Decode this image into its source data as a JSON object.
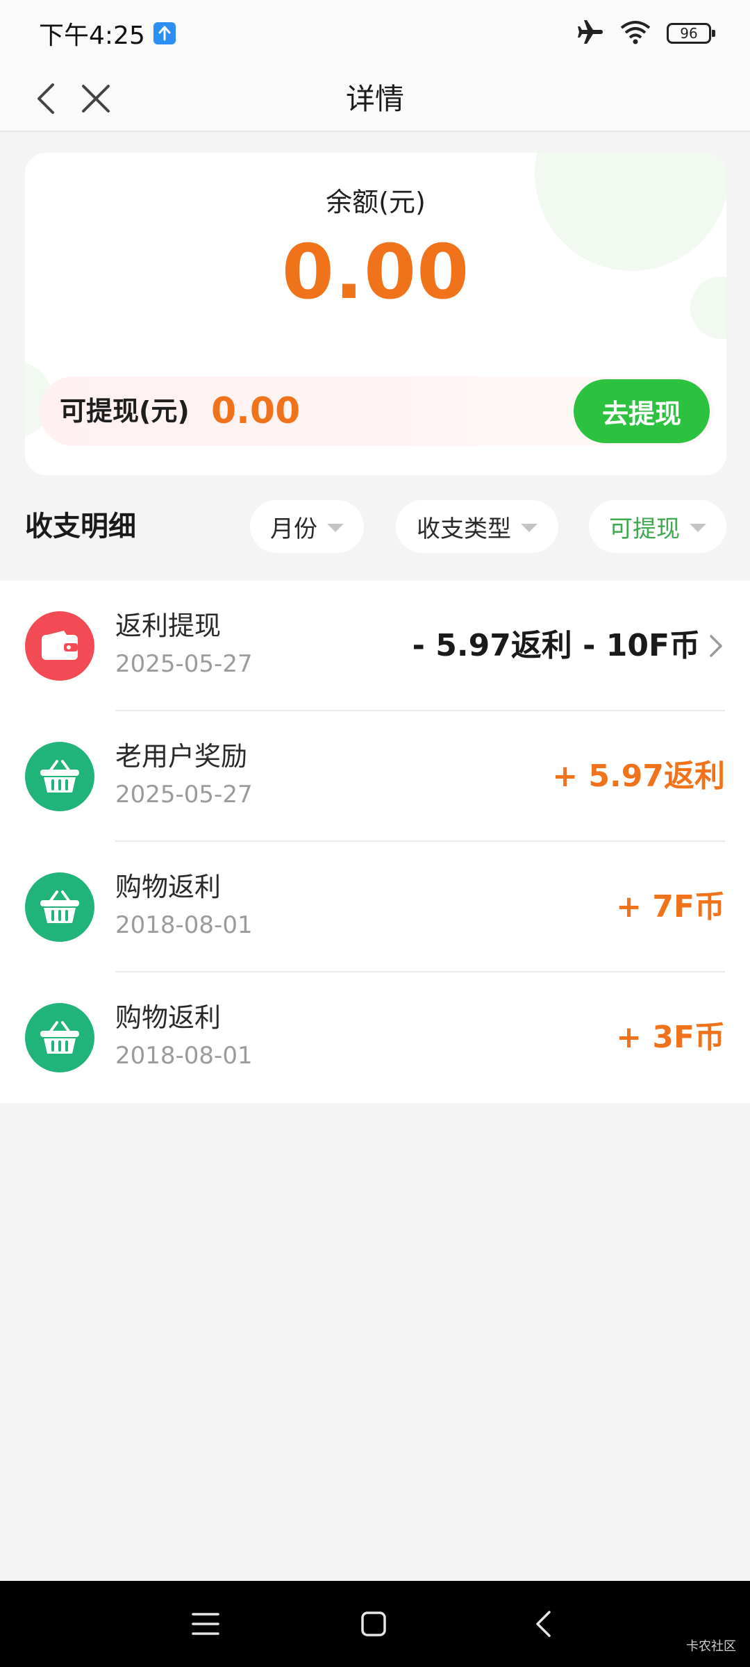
{
  "status_bar": {
    "time": "下午4:25",
    "battery": "96"
  },
  "nav": {
    "title": "详情"
  },
  "balance": {
    "label": "余额(元)",
    "value": "0.00",
    "withdrawable_label": "可提现(元)",
    "withdrawable_value": "0.00",
    "withdraw_button": "去提现"
  },
  "filters": {
    "section_title": "收支明细",
    "month": "月份",
    "type": "收支类型",
    "withdrawable": "可提现"
  },
  "transactions": [
    {
      "title": "返利提现",
      "date": "2025-05-27",
      "amount": "- 5.97返利 - 10F币",
      "icon": "wallet-icon"
    },
    {
      "title": "老用户奖励",
      "date": "2025-05-27",
      "amount": "+ 5.97返利",
      "icon": "basket-icon"
    },
    {
      "title": "购物返利",
      "date": "2018-08-01",
      "amount": "+ 7F币",
      "icon": "basket-icon"
    },
    {
      "title": "购物返利",
      "date": "2018-08-01",
      "amount": "+ 3F币",
      "icon": "basket-icon"
    }
  ],
  "watermark": "卡农社区",
  "colors": {
    "accent_orange": "#f0731b",
    "button_green": "#2cc13f",
    "icon_red": "#f24b55",
    "icon_green": "#20b37a",
    "filter_active": "#3ea94e"
  }
}
